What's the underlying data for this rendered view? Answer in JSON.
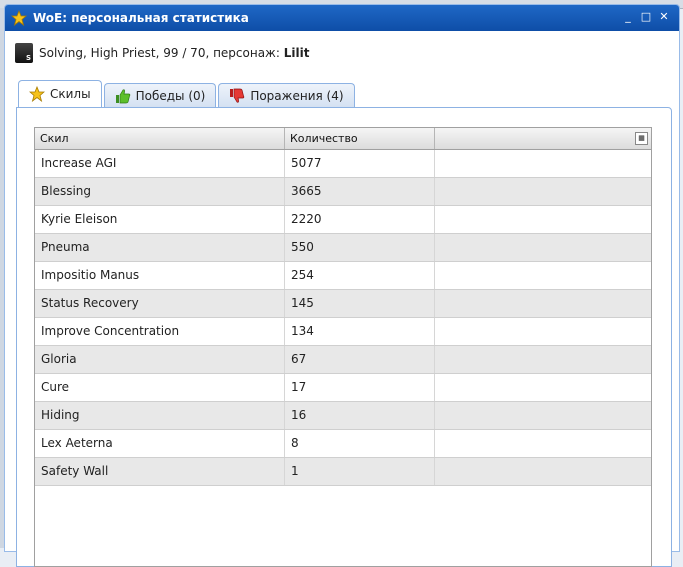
{
  "window": {
    "title": "WoE: персональная статистика",
    "tools": [
      "_",
      "□",
      "✕"
    ]
  },
  "info": {
    "prefix": "Solving, High Priest, 99 / 70, персонаж: ",
    "character": "Lilit",
    "badge": "S"
  },
  "tabs": [
    {
      "label": "Скилы",
      "icon": "star-icon"
    },
    {
      "label": "Победы (0)",
      "icon": "thumbs-up-icon"
    },
    {
      "label": "Поражения (4)",
      "icon": "thumbs-down-icon"
    }
  ],
  "grid": {
    "columns": [
      "Скил",
      "Количество",
      ""
    ],
    "rows": [
      {
        "skill": "Increase AGI",
        "count": "5077"
      },
      {
        "skill": "Blessing",
        "count": "3665"
      },
      {
        "skill": "Kyrie Eleison",
        "count": "2220"
      },
      {
        "skill": "Pneuma",
        "count": "550"
      },
      {
        "skill": "Impositio Manus",
        "count": "254"
      },
      {
        "skill": "Status Recovery",
        "count": "145"
      },
      {
        "skill": "Improve Concentration",
        "count": "134"
      },
      {
        "skill": "Gloria",
        "count": "67"
      },
      {
        "skill": "Cure",
        "count": "17"
      },
      {
        "skill": "Hiding",
        "count": "16"
      },
      {
        "skill": "Lex Aeterna",
        "count": "8"
      },
      {
        "skill": "Safety Wall",
        "count": "1"
      }
    ]
  },
  "colors": {
    "titlebar": "#1f68c6",
    "tab_border": "#8db2e3",
    "alt_row": "#e8e8e8"
  }
}
